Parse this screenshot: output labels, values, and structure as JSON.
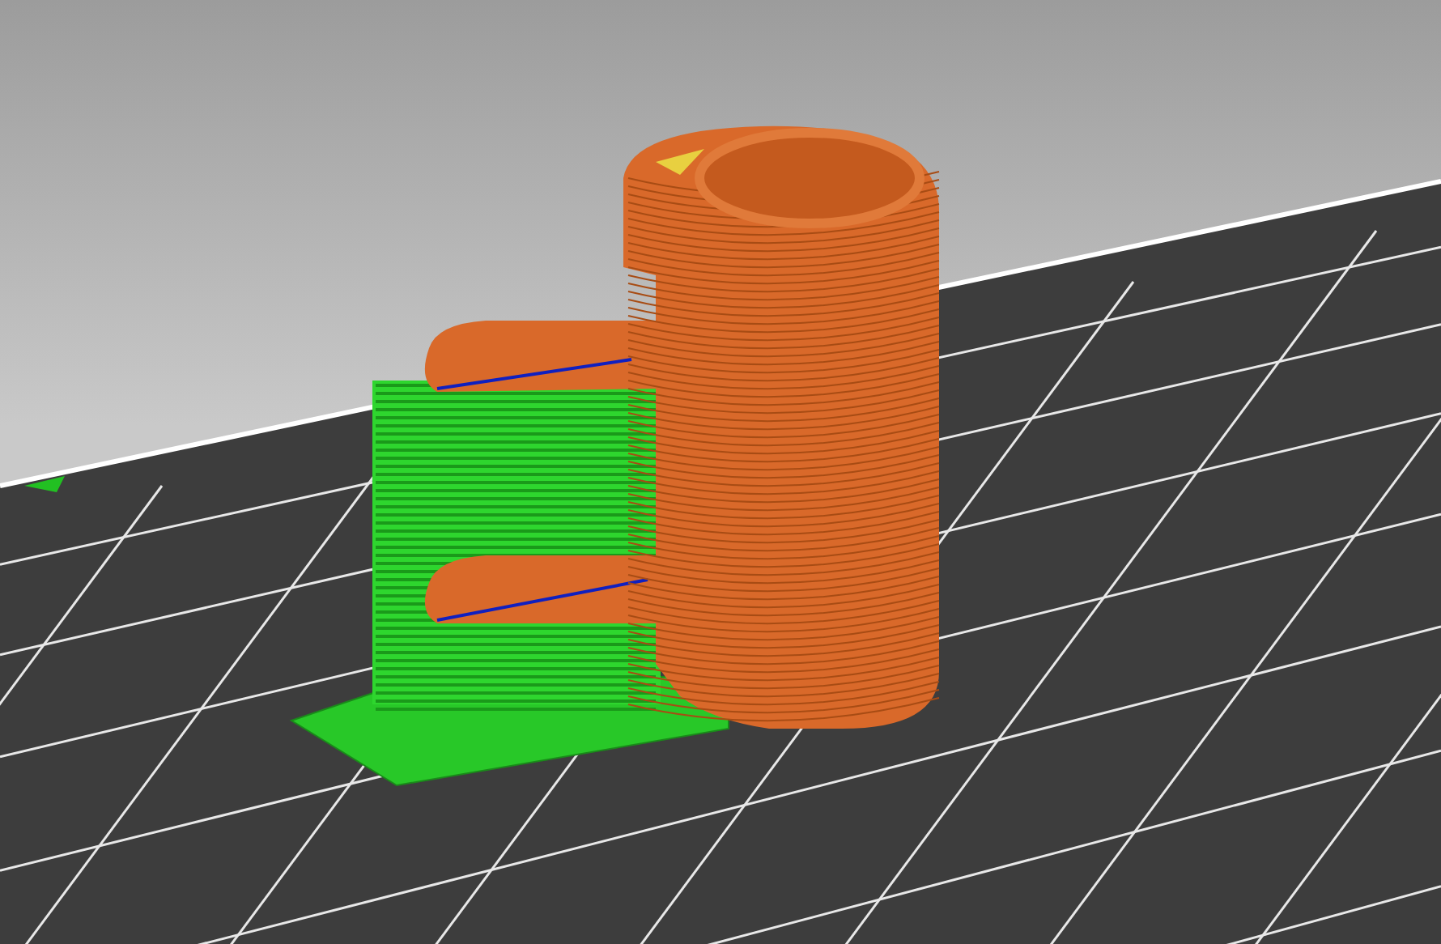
{
  "viewport": {
    "objects": [
      {
        "kind": "support"
      },
      {
        "kind": "model"
      }
    ]
  }
}
